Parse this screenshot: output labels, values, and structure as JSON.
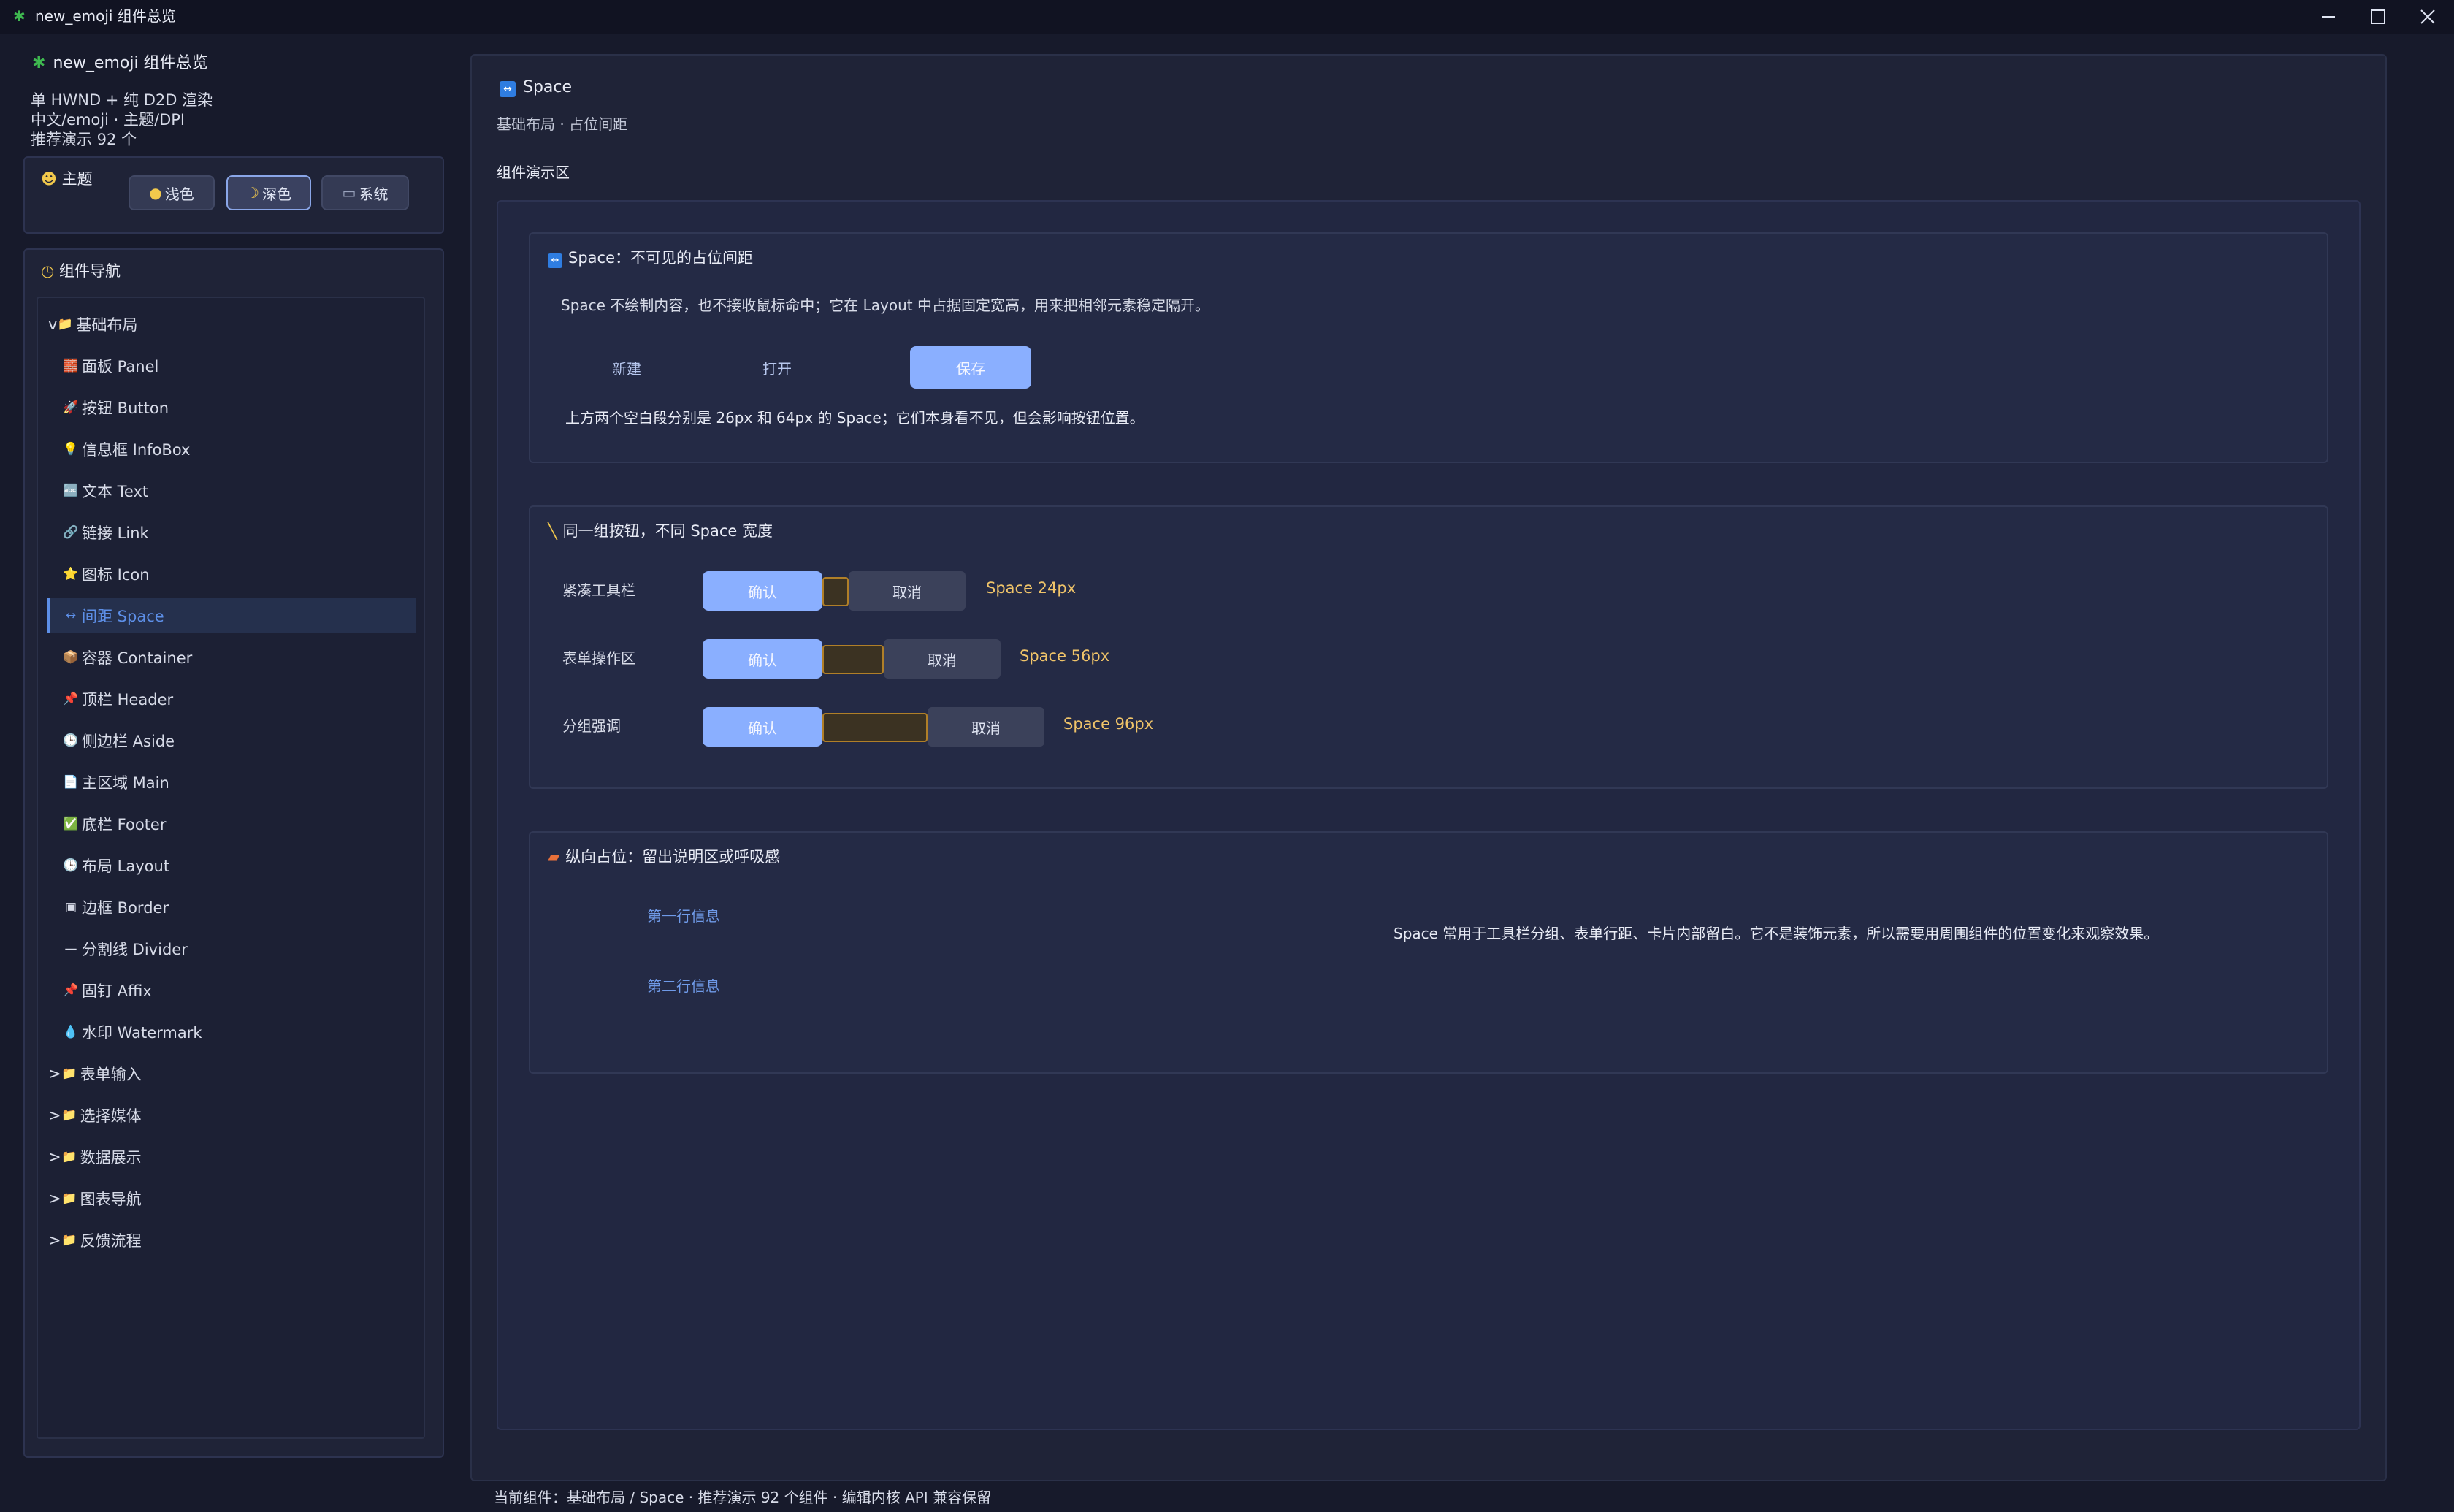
{
  "window": {
    "title": "new_emoji 组件总览",
    "app_icon": "puzzle-icon"
  },
  "sidebar": {
    "app_title": "new_emoji 组件总览",
    "info_lines": [
      "单 HWND + 纯 D2D 渲染",
      "中文/emoji · 主题/DPI",
      "推荐演示 92 个"
    ],
    "theme": {
      "label": "主题",
      "buttons": [
        {
          "icon": "●",
          "label": "浅色",
          "active": false
        },
        {
          "icon": "☽",
          "label": "深色",
          "active": true
        },
        {
          "icon": "▭",
          "label": "系统",
          "active": false
        }
      ]
    },
    "nav": {
      "title": "组件导航",
      "items": [
        {
          "prefix": "v",
          "icon": "📁",
          "label": "基础布局",
          "level": 0
        },
        {
          "icon": "🧱",
          "label": "面板 Panel",
          "level": 1
        },
        {
          "icon": "🚀",
          "label": "按钮 Button",
          "level": 1
        },
        {
          "icon": "💡",
          "label": "信息框 InfoBox",
          "level": 1
        },
        {
          "icon": "🔤",
          "label": "文本 Text",
          "level": 1
        },
        {
          "icon": "🔗",
          "label": "链接 Link",
          "level": 1
        },
        {
          "icon": "⭐",
          "label": "图标 Icon",
          "level": 1
        },
        {
          "icon": "↔",
          "label": "间距 Space",
          "level": 1,
          "selected": true
        },
        {
          "icon": "📦",
          "label": "容器 Container",
          "level": 1
        },
        {
          "icon": "📌",
          "label": "顶栏 Header",
          "level": 1
        },
        {
          "icon": "🕒",
          "label": "侧边栏 Aside",
          "level": 1
        },
        {
          "icon": "📄",
          "label": "主区域 Main",
          "level": 1
        },
        {
          "icon": "✅",
          "label": "底栏 Footer",
          "level": 1
        },
        {
          "icon": "🕒",
          "label": "布局 Layout",
          "level": 1
        },
        {
          "icon": "▣",
          "label": "边框 Border",
          "level": 1
        },
        {
          "icon": "—",
          "label": "分割线 Divider",
          "level": 1
        },
        {
          "icon": "📌",
          "label": "固钉 Affix",
          "level": 1
        },
        {
          "icon": "💧",
          "label": "水印 Watermark",
          "level": 1
        },
        {
          "prefix": ">",
          "icon": "📁",
          "label": "表单输入",
          "level": 0
        },
        {
          "prefix": ">",
          "icon": "📁",
          "label": "选择媒体",
          "level": 0
        },
        {
          "prefix": ">",
          "icon": "📁",
          "label": "数据展示",
          "level": 0
        },
        {
          "prefix": ">",
          "icon": "📁",
          "label": "图表导航",
          "level": 0
        },
        {
          "prefix": ">",
          "icon": "📁",
          "label": "反馈流程",
          "level": 0
        }
      ]
    }
  },
  "main": {
    "title": "Space",
    "subtitle": "基础布局 · 占位间距",
    "demo_label": "组件演示区",
    "card1": {
      "title": "Space：不可见的占位间距",
      "description": "Space 不绘制内容，也不接收鼠标命中；它在 Layout 中占据固定宽高，用来把相邻元素稳定隔开。",
      "buttons": [
        "新建",
        "打开",
        "保存"
      ],
      "note": "上方两个空白段分别是 26px 和 64px 的 Space；它们本身看不见，但会影响按钮位置。"
    },
    "card2": {
      "title": "同一组按钮，不同 Space 宽度",
      "rows": [
        {
          "label": "紧凑工具栏",
          "confirm": "确认",
          "cancel": "取消",
          "space": "Space 24px"
        },
        {
          "label": "表单操作区",
          "confirm": "确认",
          "cancel": "取消",
          "space": "Space 56px"
        },
        {
          "label": "分组强调",
          "confirm": "确认",
          "cancel": "取消",
          "space": "Space 96px"
        }
      ]
    },
    "card3": {
      "title": "纵向占位：留出说明区或呼吸感",
      "line1": "第一行信息",
      "line2": "第二行信息",
      "description": "Space 常用于工具栏分组、表单行距、卡片内部留白。它不是装饰元素，所以需要用周围组件的位置变化来观察效果。"
    }
  },
  "status": "当前组件：基础布局 / Space · 推荐演示 92 个组件 · 编辑内核 API 兼容保留",
  "colors": {
    "background": "#171a2b",
    "panel": "#1f2337",
    "accent": "#8aafff",
    "selected_text": "#5d8fe8",
    "space_marker": "#b07f28",
    "space_label": "#f0c469"
  }
}
